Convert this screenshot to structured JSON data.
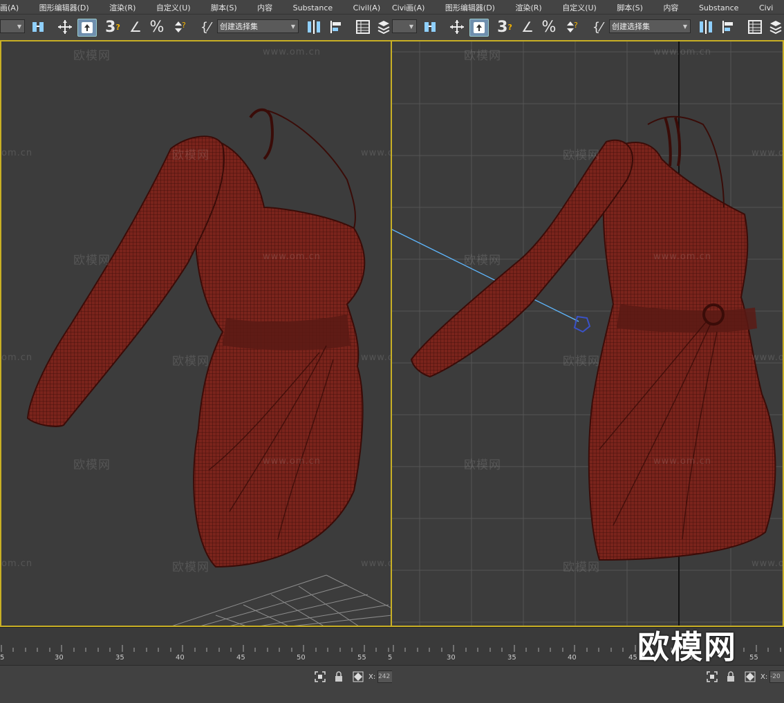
{
  "menu": {
    "items": [
      "画(A)",
      "图形编辑器(D)",
      "渲染(R)",
      "自定义(U)",
      "脚本(S)",
      "内容",
      "Substance",
      "Civil(A)"
    ],
    "items_right": [
      "Civi画(A)",
      "图形编辑器(D)",
      "渲染(R)",
      "自定义(U)",
      "脚本(S)",
      "内容",
      "Substance",
      "Civi"
    ]
  },
  "toolbar": {
    "selection_set_label": "创建选择集",
    "snap_label": "3",
    "angle_snap": "∠",
    "percent_snap": "%"
  },
  "watermark": {
    "site_cn": "欧模网",
    "site_url": "www.om.cn",
    "site_short": "om.cn",
    "logo_text": "欧模网"
  },
  "timeline": {
    "ticks_left": [
      "5",
      "30",
      "35",
      "40",
      "45",
      "50",
      "55",
      "5"
    ],
    "ticks_right": [
      "30",
      "35",
      "40",
      "45",
      "50",
      "55"
    ]
  },
  "status": {
    "x_label": "X:",
    "x_value_left": "242",
    "x_value_right": "-20"
  },
  "colors": {
    "viewport_border": "#c9b024",
    "mesh_fill": "#7a241c",
    "mesh_line": "#3a0c08",
    "toolbar_bg": "#444444"
  }
}
